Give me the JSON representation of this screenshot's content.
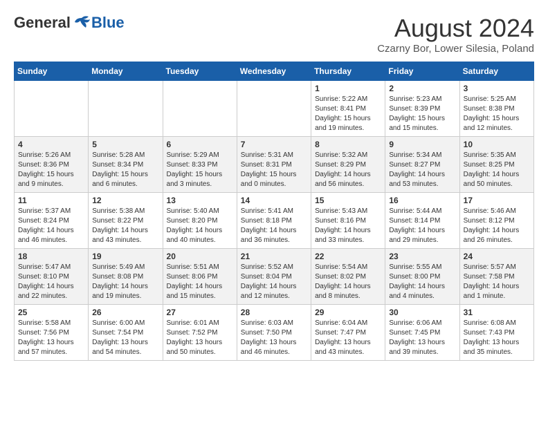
{
  "header": {
    "logo_general": "General",
    "logo_blue": "Blue",
    "month_title": "August 2024",
    "subtitle": "Czarny Bor, Lower Silesia, Poland"
  },
  "days_of_week": [
    "Sunday",
    "Monday",
    "Tuesday",
    "Wednesday",
    "Thursday",
    "Friday",
    "Saturday"
  ],
  "weeks": [
    [
      {
        "day": "",
        "info": ""
      },
      {
        "day": "",
        "info": ""
      },
      {
        "day": "",
        "info": ""
      },
      {
        "day": "",
        "info": ""
      },
      {
        "day": "1",
        "info": "Sunrise: 5:22 AM\nSunset: 8:41 PM\nDaylight: 15 hours\nand 19 minutes."
      },
      {
        "day": "2",
        "info": "Sunrise: 5:23 AM\nSunset: 8:39 PM\nDaylight: 15 hours\nand 15 minutes."
      },
      {
        "day": "3",
        "info": "Sunrise: 5:25 AM\nSunset: 8:38 PM\nDaylight: 15 hours\nand 12 minutes."
      }
    ],
    [
      {
        "day": "4",
        "info": "Sunrise: 5:26 AM\nSunset: 8:36 PM\nDaylight: 15 hours\nand 9 minutes."
      },
      {
        "day": "5",
        "info": "Sunrise: 5:28 AM\nSunset: 8:34 PM\nDaylight: 15 hours\nand 6 minutes."
      },
      {
        "day": "6",
        "info": "Sunrise: 5:29 AM\nSunset: 8:33 PM\nDaylight: 15 hours\nand 3 minutes."
      },
      {
        "day": "7",
        "info": "Sunrise: 5:31 AM\nSunset: 8:31 PM\nDaylight: 15 hours\nand 0 minutes."
      },
      {
        "day": "8",
        "info": "Sunrise: 5:32 AM\nSunset: 8:29 PM\nDaylight: 14 hours\nand 56 minutes."
      },
      {
        "day": "9",
        "info": "Sunrise: 5:34 AM\nSunset: 8:27 PM\nDaylight: 14 hours\nand 53 minutes."
      },
      {
        "day": "10",
        "info": "Sunrise: 5:35 AM\nSunset: 8:25 PM\nDaylight: 14 hours\nand 50 minutes."
      }
    ],
    [
      {
        "day": "11",
        "info": "Sunrise: 5:37 AM\nSunset: 8:24 PM\nDaylight: 14 hours\nand 46 minutes."
      },
      {
        "day": "12",
        "info": "Sunrise: 5:38 AM\nSunset: 8:22 PM\nDaylight: 14 hours\nand 43 minutes."
      },
      {
        "day": "13",
        "info": "Sunrise: 5:40 AM\nSunset: 8:20 PM\nDaylight: 14 hours\nand 40 minutes."
      },
      {
        "day": "14",
        "info": "Sunrise: 5:41 AM\nSunset: 8:18 PM\nDaylight: 14 hours\nand 36 minutes."
      },
      {
        "day": "15",
        "info": "Sunrise: 5:43 AM\nSunset: 8:16 PM\nDaylight: 14 hours\nand 33 minutes."
      },
      {
        "day": "16",
        "info": "Sunrise: 5:44 AM\nSunset: 8:14 PM\nDaylight: 14 hours\nand 29 minutes."
      },
      {
        "day": "17",
        "info": "Sunrise: 5:46 AM\nSunset: 8:12 PM\nDaylight: 14 hours\nand 26 minutes."
      }
    ],
    [
      {
        "day": "18",
        "info": "Sunrise: 5:47 AM\nSunset: 8:10 PM\nDaylight: 14 hours\nand 22 minutes."
      },
      {
        "day": "19",
        "info": "Sunrise: 5:49 AM\nSunset: 8:08 PM\nDaylight: 14 hours\nand 19 minutes."
      },
      {
        "day": "20",
        "info": "Sunrise: 5:51 AM\nSunset: 8:06 PM\nDaylight: 14 hours\nand 15 minutes."
      },
      {
        "day": "21",
        "info": "Sunrise: 5:52 AM\nSunset: 8:04 PM\nDaylight: 14 hours\nand 12 minutes."
      },
      {
        "day": "22",
        "info": "Sunrise: 5:54 AM\nSunset: 8:02 PM\nDaylight: 14 hours\nand 8 minutes."
      },
      {
        "day": "23",
        "info": "Sunrise: 5:55 AM\nSunset: 8:00 PM\nDaylight: 14 hours\nand 4 minutes."
      },
      {
        "day": "24",
        "info": "Sunrise: 5:57 AM\nSunset: 7:58 PM\nDaylight: 14 hours\nand 1 minute."
      }
    ],
    [
      {
        "day": "25",
        "info": "Sunrise: 5:58 AM\nSunset: 7:56 PM\nDaylight: 13 hours\nand 57 minutes."
      },
      {
        "day": "26",
        "info": "Sunrise: 6:00 AM\nSunset: 7:54 PM\nDaylight: 13 hours\nand 54 minutes."
      },
      {
        "day": "27",
        "info": "Sunrise: 6:01 AM\nSunset: 7:52 PM\nDaylight: 13 hours\nand 50 minutes."
      },
      {
        "day": "28",
        "info": "Sunrise: 6:03 AM\nSunset: 7:50 PM\nDaylight: 13 hours\nand 46 minutes."
      },
      {
        "day": "29",
        "info": "Sunrise: 6:04 AM\nSunset: 7:47 PM\nDaylight: 13 hours\nand 43 minutes."
      },
      {
        "day": "30",
        "info": "Sunrise: 6:06 AM\nSunset: 7:45 PM\nDaylight: 13 hours\nand 39 minutes."
      },
      {
        "day": "31",
        "info": "Sunrise: 6:08 AM\nSunset: 7:43 PM\nDaylight: 13 hours\nand 35 minutes."
      }
    ]
  ]
}
